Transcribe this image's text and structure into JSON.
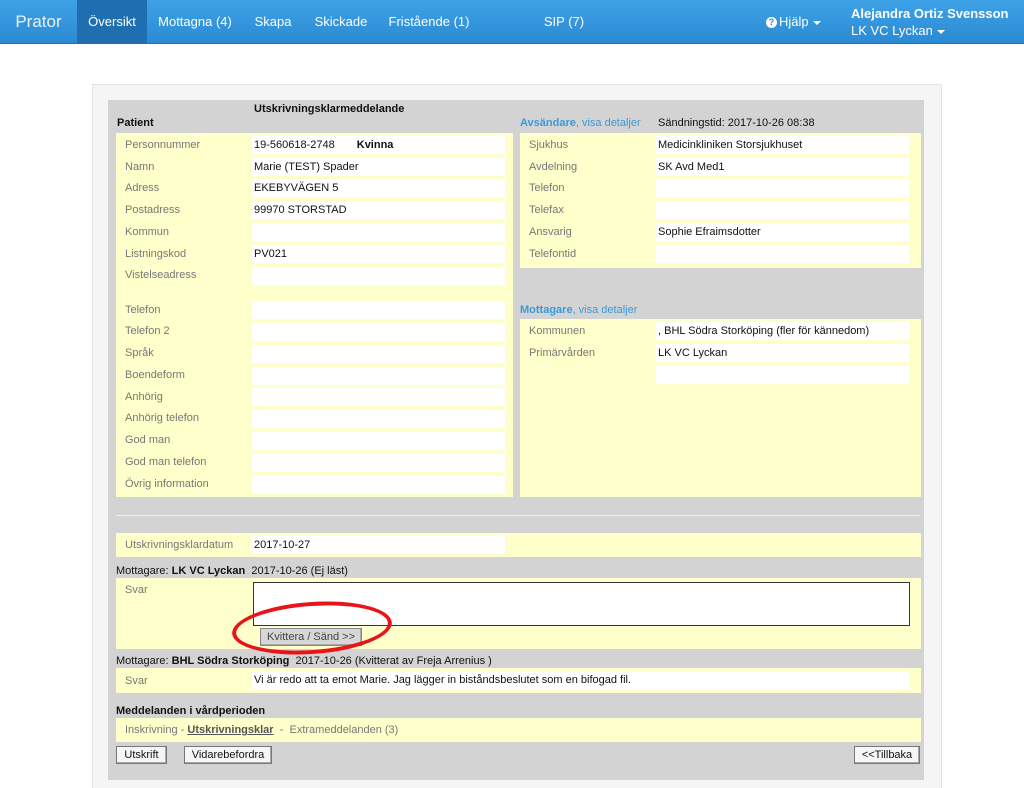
{
  "navbar": {
    "brand": "Prator",
    "items": [
      {
        "label": "Översikt",
        "active": true
      },
      {
        "label": "Mottagna (4)"
      },
      {
        "label": "Skapa"
      },
      {
        "label": "Skickade"
      },
      {
        "label": "Fristående (1)"
      },
      {
        "label": "SIP (7)"
      }
    ],
    "help": "Hjälp",
    "user_name": "Alejandra Ortiz Svensson",
    "user_unit": "LK VC Lyckan"
  },
  "form_title": "Utskrivningsklarmeddelande",
  "patient": {
    "heading": "Patient",
    "fields": [
      {
        "label": "Personnummer",
        "value": "19-560618-2748",
        "extra": "Kvinna"
      },
      {
        "label": "Namn",
        "value": "Marie (TEST)  Spader"
      },
      {
        "label": "Adress",
        "value": "EKEBYVÄGEN 5"
      },
      {
        "label": "Postadress",
        "value": "99970  STORSTAD"
      },
      {
        "label": "Kommun",
        "value": ""
      },
      {
        "label": "Listningskod",
        "value": "PV021"
      },
      {
        "label": "Vistelseadress",
        "value": ""
      },
      {
        "label": "Telefon",
        "value": ""
      },
      {
        "label": "Telefon 2",
        "value": ""
      },
      {
        "label": "Språk",
        "value": ""
      },
      {
        "label": "Boendeform",
        "value": ""
      },
      {
        "label": "Anhörig",
        "value": ""
      },
      {
        "label": "Anhörig telefon",
        "value": ""
      },
      {
        "label": "God man",
        "value": ""
      },
      {
        "label": "God man telefon",
        "value": ""
      },
      {
        "label": "Övrig information",
        "value": ""
      }
    ]
  },
  "sender": {
    "heading": "Avsändare",
    "details_link": ", visa detaljer",
    "sent_time": "Sändningstid: 2017-10-26 08:38",
    "fields": [
      {
        "label": "Sjukhus",
        "value": "Medicinkliniken Storsjukhuset"
      },
      {
        "label": "Avdelning",
        "value": "SK Avd Med1"
      },
      {
        "label": "Telefon",
        "value": ""
      },
      {
        "label": "Telefax",
        "value": ""
      },
      {
        "label": "Ansvarig",
        "value": "Sophie Efraimsdotter"
      },
      {
        "label": "Telefontid",
        "value": ""
      }
    ]
  },
  "receiver": {
    "heading": "Mottagare",
    "details_link": ", visa detaljer",
    "fields": [
      {
        "label": "Kommunen",
        "value": ", BHL Södra Storköping (fler för kännedom)"
      },
      {
        "label": "Primärvården",
        "value": "LK VC Lyckan"
      },
      {
        "label": "",
        "value": ""
      }
    ]
  },
  "discharge": {
    "label": "Utskrivningsklardatum",
    "value": "2017-10-27"
  },
  "reply1": {
    "prefix": "Mottagare:",
    "name": "LK VC Lyckan",
    "info": "2017-10-26  (Ej läst)",
    "svar_label": "Svar",
    "button": "Kvittera / Sänd >>"
  },
  "reply2": {
    "prefix": "Mottagare:",
    "name": "BHL Södra Storköping",
    "info": "2017-10-26  (Kvitterat av Freja Arrenius )",
    "svar_label": "Svar",
    "svar_value": "Vi är redo att ta emot Marie. Jag lägger in biståndsbeslutet som en bifogad fil."
  },
  "messages": {
    "heading": "Meddelanden i vårdperioden",
    "inskrivning": "Inskrivning",
    "sep": "-",
    "utskrivningsklar": "Utskrivningsklar",
    "extra": "Extrameddelanden (3)"
  },
  "buttons": {
    "print": "Utskrift",
    "forward": "Vidarebefordra",
    "back": "<<Tillbaka"
  },
  "colors": {
    "navbar": "#2a8ad4",
    "highlight_panel": "#ffffcc",
    "annotation": "#e8141a"
  }
}
